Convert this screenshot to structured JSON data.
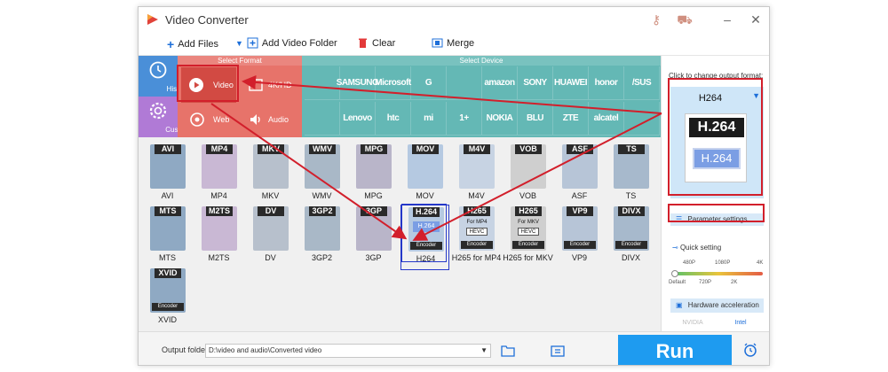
{
  "window": {
    "title": "Video Converter"
  },
  "toolbar": {
    "add_files": "Add Files",
    "add_video_folder": "Add Video Folder",
    "clear": "Clear",
    "merge": "Merge"
  },
  "nav": {
    "history": "History",
    "custom": "Custom"
  },
  "select_format": {
    "header": "Select Format",
    "video": "Video",
    "hd": "4K/HD",
    "web": "Web",
    "audio": "Audio"
  },
  "select_device": {
    "header": "Select Device",
    "row1": [
      "",
      "SAMSUNG",
      "Microsoft",
      "G",
      "",
      "amazon",
      "SONY",
      "HUAWEI",
      "honor",
      "/SUS"
    ],
    "row2": [
      "",
      "Lenovo",
      "htc",
      "mi",
      "1+",
      "NOKIA",
      "BLU",
      "ZTE",
      "alcatel",
      ""
    ]
  },
  "formats_row1": [
    {
      "tag": "AVI",
      "caption": "AVI"
    },
    {
      "tag": "MP4",
      "caption": "MP4"
    },
    {
      "tag": "MKV",
      "caption": "MKV"
    },
    {
      "tag": "WMV",
      "caption": "WMV"
    },
    {
      "tag": "MPG",
      "caption": "MPG"
    },
    {
      "tag": "MOV",
      "caption": "MOV"
    },
    {
      "tag": "M4V",
      "caption": "M4V"
    },
    {
      "tag": "VOB",
      "caption": "VOB"
    },
    {
      "tag": "ASF",
      "caption": "ASF"
    },
    {
      "tag": "TS",
      "caption": "TS"
    }
  ],
  "formats_row2": [
    {
      "tag": "MTS",
      "caption": "MTS"
    },
    {
      "tag": "M2TS",
      "caption": "M2TS"
    },
    {
      "tag": "DV",
      "caption": "DV"
    },
    {
      "tag": "3GP2",
      "caption": "3GP2"
    },
    {
      "tag": "3GP",
      "caption": "3GP"
    },
    {
      "tag": "H.264",
      "caption": "H264",
      "sub": "H.264",
      "enc": "Encoder"
    },
    {
      "tag": "H265",
      "caption": "H265 for MP4",
      "sub": "For MP4",
      "sub2": "HEVC",
      "enc": "Encoder"
    },
    {
      "tag": "H265",
      "caption": "H265 for MKV",
      "sub": "For MKV",
      "sub2": "HEVC",
      "enc": "Encoder"
    },
    {
      "tag": "VP9",
      "caption": "VP9",
      "enc": "Encoder"
    },
    {
      "tag": "DIVX",
      "caption": "DIVX",
      "enc": "Encoder"
    }
  ],
  "formats_row3": [
    {
      "tag": "XVID",
      "caption": "XVID",
      "enc": "Encoder"
    }
  ],
  "output_panel": {
    "hint": "Click to change output format:",
    "format": "H264",
    "big_label": "H.264",
    "small_label": "H.264",
    "param_settings": "Parameter settings",
    "quick_setting": "Quick setting",
    "quality_top": [
      "480P",
      "1080P",
      "4K"
    ],
    "quality_bottom": [
      "Default",
      "720P",
      "2K"
    ],
    "hw_accel": "Hardware acceleration",
    "nvidia": "NVIDIA",
    "intel": "Intel"
  },
  "bottom": {
    "output_label": "Output folder:",
    "output_path": "D:\\video and audio\\Converted video",
    "run": "Run"
  },
  "colors": {
    "format_red": "#e7736a",
    "device_teal": "#64b8b5",
    "run_blue": "#1e9bf0",
    "annotation_red": "#d21f2b"
  }
}
